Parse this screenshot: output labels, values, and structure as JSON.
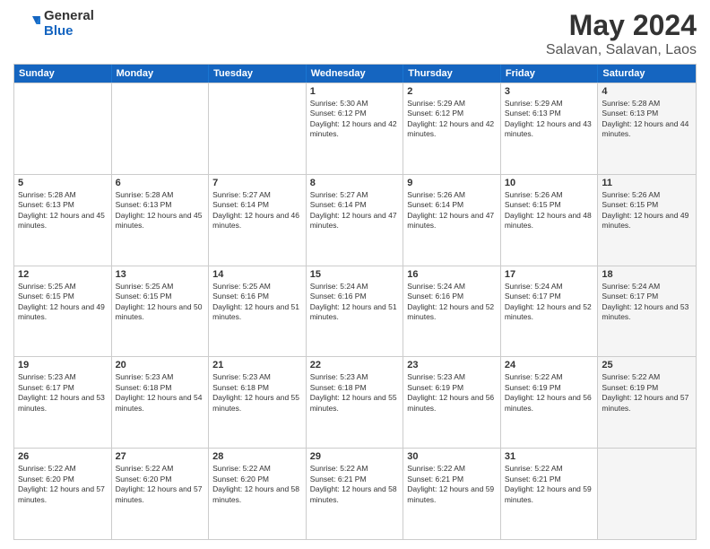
{
  "logo": {
    "general": "General",
    "blue": "Blue"
  },
  "title": "May 2024",
  "location": "Salavan, Salavan, Laos",
  "header_days": [
    "Sunday",
    "Monday",
    "Tuesday",
    "Wednesday",
    "Thursday",
    "Friday",
    "Saturday"
  ],
  "weeks": [
    [
      {
        "day": "",
        "sunrise": "",
        "sunset": "",
        "daylight": "",
        "shaded": false
      },
      {
        "day": "",
        "sunrise": "",
        "sunset": "",
        "daylight": "",
        "shaded": false
      },
      {
        "day": "",
        "sunrise": "",
        "sunset": "",
        "daylight": "",
        "shaded": false
      },
      {
        "day": "1",
        "sunrise": "Sunrise: 5:30 AM",
        "sunset": "Sunset: 6:12 PM",
        "daylight": "Daylight: 12 hours and 42 minutes.",
        "shaded": false
      },
      {
        "day": "2",
        "sunrise": "Sunrise: 5:29 AM",
        "sunset": "Sunset: 6:12 PM",
        "daylight": "Daylight: 12 hours and 42 minutes.",
        "shaded": false
      },
      {
        "day": "3",
        "sunrise": "Sunrise: 5:29 AM",
        "sunset": "Sunset: 6:13 PM",
        "daylight": "Daylight: 12 hours and 43 minutes.",
        "shaded": false
      },
      {
        "day": "4",
        "sunrise": "Sunrise: 5:28 AM",
        "sunset": "Sunset: 6:13 PM",
        "daylight": "Daylight: 12 hours and 44 minutes.",
        "shaded": true
      }
    ],
    [
      {
        "day": "5",
        "sunrise": "Sunrise: 5:28 AM",
        "sunset": "Sunset: 6:13 PM",
        "daylight": "Daylight: 12 hours and 45 minutes.",
        "shaded": false
      },
      {
        "day": "6",
        "sunrise": "Sunrise: 5:28 AM",
        "sunset": "Sunset: 6:13 PM",
        "daylight": "Daylight: 12 hours and 45 minutes.",
        "shaded": false
      },
      {
        "day": "7",
        "sunrise": "Sunrise: 5:27 AM",
        "sunset": "Sunset: 6:14 PM",
        "daylight": "Daylight: 12 hours and 46 minutes.",
        "shaded": false
      },
      {
        "day": "8",
        "sunrise": "Sunrise: 5:27 AM",
        "sunset": "Sunset: 6:14 PM",
        "daylight": "Daylight: 12 hours and 47 minutes.",
        "shaded": false
      },
      {
        "day": "9",
        "sunrise": "Sunrise: 5:26 AM",
        "sunset": "Sunset: 6:14 PM",
        "daylight": "Daylight: 12 hours and 47 minutes.",
        "shaded": false
      },
      {
        "day": "10",
        "sunrise": "Sunrise: 5:26 AM",
        "sunset": "Sunset: 6:15 PM",
        "daylight": "Daylight: 12 hours and 48 minutes.",
        "shaded": false
      },
      {
        "day": "11",
        "sunrise": "Sunrise: 5:26 AM",
        "sunset": "Sunset: 6:15 PM",
        "daylight": "Daylight: 12 hours and 49 minutes.",
        "shaded": true
      }
    ],
    [
      {
        "day": "12",
        "sunrise": "Sunrise: 5:25 AM",
        "sunset": "Sunset: 6:15 PM",
        "daylight": "Daylight: 12 hours and 49 minutes.",
        "shaded": false
      },
      {
        "day": "13",
        "sunrise": "Sunrise: 5:25 AM",
        "sunset": "Sunset: 6:15 PM",
        "daylight": "Daylight: 12 hours and 50 minutes.",
        "shaded": false
      },
      {
        "day": "14",
        "sunrise": "Sunrise: 5:25 AM",
        "sunset": "Sunset: 6:16 PM",
        "daylight": "Daylight: 12 hours and 51 minutes.",
        "shaded": false
      },
      {
        "day": "15",
        "sunrise": "Sunrise: 5:24 AM",
        "sunset": "Sunset: 6:16 PM",
        "daylight": "Daylight: 12 hours and 51 minutes.",
        "shaded": false
      },
      {
        "day": "16",
        "sunrise": "Sunrise: 5:24 AM",
        "sunset": "Sunset: 6:16 PM",
        "daylight": "Daylight: 12 hours and 52 minutes.",
        "shaded": false
      },
      {
        "day": "17",
        "sunrise": "Sunrise: 5:24 AM",
        "sunset": "Sunset: 6:17 PM",
        "daylight": "Daylight: 12 hours and 52 minutes.",
        "shaded": false
      },
      {
        "day": "18",
        "sunrise": "Sunrise: 5:24 AM",
        "sunset": "Sunset: 6:17 PM",
        "daylight": "Daylight: 12 hours and 53 minutes.",
        "shaded": true
      }
    ],
    [
      {
        "day": "19",
        "sunrise": "Sunrise: 5:23 AM",
        "sunset": "Sunset: 6:17 PM",
        "daylight": "Daylight: 12 hours and 53 minutes.",
        "shaded": false
      },
      {
        "day": "20",
        "sunrise": "Sunrise: 5:23 AM",
        "sunset": "Sunset: 6:18 PM",
        "daylight": "Daylight: 12 hours and 54 minutes.",
        "shaded": false
      },
      {
        "day": "21",
        "sunrise": "Sunrise: 5:23 AM",
        "sunset": "Sunset: 6:18 PM",
        "daylight": "Daylight: 12 hours and 55 minutes.",
        "shaded": false
      },
      {
        "day": "22",
        "sunrise": "Sunrise: 5:23 AM",
        "sunset": "Sunset: 6:18 PM",
        "daylight": "Daylight: 12 hours and 55 minutes.",
        "shaded": false
      },
      {
        "day": "23",
        "sunrise": "Sunrise: 5:23 AM",
        "sunset": "Sunset: 6:19 PM",
        "daylight": "Daylight: 12 hours and 56 minutes.",
        "shaded": false
      },
      {
        "day": "24",
        "sunrise": "Sunrise: 5:22 AM",
        "sunset": "Sunset: 6:19 PM",
        "daylight": "Daylight: 12 hours and 56 minutes.",
        "shaded": false
      },
      {
        "day": "25",
        "sunrise": "Sunrise: 5:22 AM",
        "sunset": "Sunset: 6:19 PM",
        "daylight": "Daylight: 12 hours and 57 minutes.",
        "shaded": true
      }
    ],
    [
      {
        "day": "26",
        "sunrise": "Sunrise: 5:22 AM",
        "sunset": "Sunset: 6:20 PM",
        "daylight": "Daylight: 12 hours and 57 minutes.",
        "shaded": false
      },
      {
        "day": "27",
        "sunrise": "Sunrise: 5:22 AM",
        "sunset": "Sunset: 6:20 PM",
        "daylight": "Daylight: 12 hours and 57 minutes.",
        "shaded": false
      },
      {
        "day": "28",
        "sunrise": "Sunrise: 5:22 AM",
        "sunset": "Sunset: 6:20 PM",
        "daylight": "Daylight: 12 hours and 58 minutes.",
        "shaded": false
      },
      {
        "day": "29",
        "sunrise": "Sunrise: 5:22 AM",
        "sunset": "Sunset: 6:21 PM",
        "daylight": "Daylight: 12 hours and 58 minutes.",
        "shaded": false
      },
      {
        "day": "30",
        "sunrise": "Sunrise: 5:22 AM",
        "sunset": "Sunset: 6:21 PM",
        "daylight": "Daylight: 12 hours and 59 minutes.",
        "shaded": false
      },
      {
        "day": "31",
        "sunrise": "Sunrise: 5:22 AM",
        "sunset": "Sunset: 6:21 PM",
        "daylight": "Daylight: 12 hours and 59 minutes.",
        "shaded": false
      },
      {
        "day": "",
        "sunrise": "",
        "sunset": "",
        "daylight": "",
        "shaded": true
      }
    ]
  ]
}
